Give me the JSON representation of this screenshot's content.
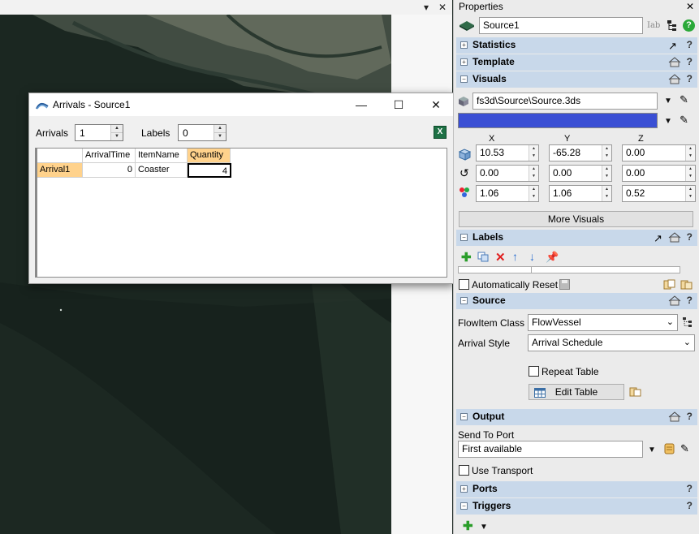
{
  "viewport": {
    "pin_glyph": "▾",
    "close_glyph": "✕"
  },
  "dialog": {
    "title": "Arrivals - Source1",
    "minimize_glyph": "—",
    "maximize_glyph": "☐",
    "close_glyph": "✕",
    "arrivals_label": "Arrivals",
    "arrivals_value": "1",
    "labels_label": "Labels",
    "labels_value": "0",
    "excel_icon_text": "X",
    "table": {
      "columns": [
        "ArrivalTime",
        "ItemName",
        "Quantity"
      ],
      "rows": [
        {
          "header": "Arrival1",
          "cells": [
            "0",
            "Coaster",
            "4"
          ]
        }
      ]
    }
  },
  "properties": {
    "header_title": "Properties",
    "close_glyph": "✕",
    "object_name": "Source1",
    "object_icon_text": "Iab",
    "sections": {
      "statistics": "Statistics",
      "template": "Template",
      "visuals": "Visuals",
      "labels": "Labels",
      "source": "Source",
      "output": "Output",
      "ports": "Ports",
      "triggers": "Triggers"
    },
    "help_glyph": "?",
    "visuals": {
      "shape_file": "fs3d\\Source\\Source.3ds",
      "color": "#3a4fd4",
      "axis_x": "X",
      "axis_y": "Y",
      "axis_z": "Z",
      "position": [
        "10.53",
        "-65.28",
        "0.00"
      ],
      "rotation": [
        "0.00",
        "0.00",
        "0.00"
      ],
      "size": [
        "1.06",
        "1.06",
        "0.52"
      ],
      "more_visuals": "More Visuals"
    },
    "labels": {
      "auto_reset": "Automatically Reset"
    },
    "source": {
      "flowitem_label": "FlowItem Class",
      "flowitem_value": "FlowVessel",
      "arrival_label": "Arrival Style",
      "arrival_value": "Arrival Schedule",
      "repeat_table": "Repeat Table",
      "edit_table": "Edit Table"
    },
    "output": {
      "send_to_label": "Send To Port",
      "send_to_value": "First available",
      "use_transport": "Use Transport"
    }
  }
}
